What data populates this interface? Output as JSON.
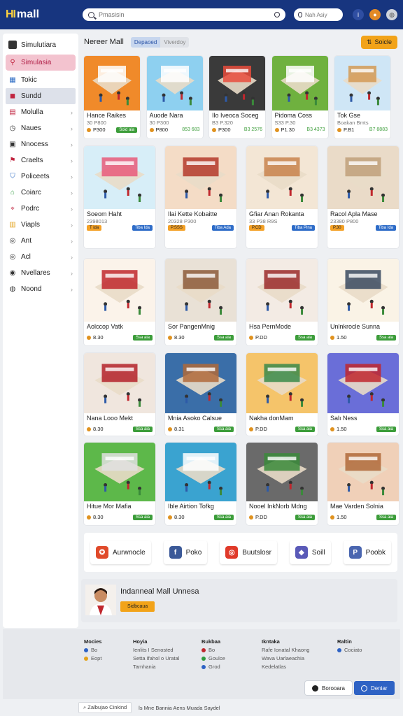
{
  "header": {
    "logo_mark": "HI",
    "logo_text": "mall",
    "search_placeholder": "Pmasisin",
    "search2_placeholder": "Nah Asiy"
  },
  "sidebar": {
    "title": "Simulutiara",
    "items": [
      {
        "label": "Simulasia",
        "icon": "search-icon",
        "state": "active"
      },
      {
        "label": "Tokic",
        "icon": "store-icon",
        "state": ""
      },
      {
        "label": "Sundd",
        "icon": "square-icon",
        "state": "selected"
      },
      {
        "label": "Molulla",
        "icon": "bar-chart-icon",
        "state": ""
      },
      {
        "label": "Naues",
        "icon": "clock-icon",
        "state": ""
      },
      {
        "label": "Nnocess",
        "icon": "grid-icon",
        "state": ""
      },
      {
        "label": "Craelts",
        "icon": "flag-icon",
        "state": ""
      },
      {
        "label": "Policeets",
        "icon": "shield-icon",
        "state": ""
      },
      {
        "label": "Coiarc",
        "icon": "shop-icon",
        "state": ""
      },
      {
        "label": "Podrc",
        "icon": "pin-icon",
        "state": ""
      },
      {
        "label": "Viapls",
        "icon": "bag-icon",
        "state": ""
      },
      {
        "label": "Ant",
        "icon": "compass-icon",
        "state": ""
      },
      {
        "label": "Acl",
        "icon": "compass-icon",
        "state": ""
      },
      {
        "label": "Nvellares",
        "icon": "target-icon",
        "state": ""
      },
      {
        "label": "Noond",
        "icon": "globe-icon",
        "state": ""
      }
    ]
  },
  "main": {
    "title": "Nereer Mall",
    "toggle": [
      "Depaoed",
      "Viverdoy"
    ],
    "sort_label": "Soicle"
  },
  "cards": [
    {
      "name": "Hance Raikes",
      "sub": "30 P800",
      "price": "P300",
      "badge": "Soid aia",
      "badge_type": "green"
    },
    {
      "name": "Auode Nara",
      "sub": "30 P300",
      "price": "P800",
      "badge": "853 683",
      "badge_type": "none"
    },
    {
      "name": "Ilo Iveoca Soceg",
      "sub": "B3 P.320",
      "price": "P300",
      "badge": "B3 2576",
      "badge_type": "none"
    },
    {
      "name": "Pidoma Coss",
      "sub": "S33 P.30",
      "price": "P1.30",
      "badge": "B3 4373",
      "badge_type": "none"
    },
    {
      "name": "Tok Gse",
      "sub": "Boakan Bmts",
      "price": "P.B1",
      "badge": "B7 8883",
      "badge_type": "none"
    },
    {
      "name": "Soeom Haht",
      "sub": "2398013",
      "price": "T ida",
      "badge": "Tiba Ida",
      "badge_type": "blue"
    },
    {
      "name": "Ilai Kette Kobaitte",
      "sub": "20328 P300",
      "price": "P.SSS",
      "badge": "Tiba Ada",
      "badge_type": "blue"
    },
    {
      "name": "Gfiar Anan Rokanta",
      "sub": "33 P38 R9S",
      "price": "P.CD",
      "badge": "Tiba Pina",
      "badge_type": "blue"
    },
    {
      "name": "Racol Apla Mase",
      "sub": "23380 P800",
      "price": "P.30",
      "badge": "Tiba Ida",
      "badge_type": "blue"
    },
    {
      "name": "Aolccop Vatk",
      "sub": "",
      "price": "8.30",
      "badge": "Ssa aia",
      "badge_type": "green"
    },
    {
      "name": "Sor PangenMnig",
      "sub": "",
      "price": "8.30",
      "badge": "Ssa aia",
      "badge_type": "green"
    },
    {
      "name": "Hsa PernMode",
      "sub": "",
      "price": "P.DD",
      "badge": "Ssa aia",
      "badge_type": "green"
    },
    {
      "name": "Unlnkrocle Sunna",
      "sub": "",
      "price": "1.50",
      "badge": "Ssa aia",
      "badge_type": "green"
    },
    {
      "name": "Nana Looo Mekt",
      "sub": "",
      "price": "8.30",
      "badge": "Ssa aia",
      "badge_type": "green"
    },
    {
      "name": "Mnia Asoko Calsue",
      "sub": "",
      "price": "8.31",
      "badge": "Ssa aia",
      "badge_type": "green"
    },
    {
      "name": "Nakha donMam",
      "sub": "",
      "price": "P.DD",
      "badge": "Ssa aia",
      "badge_type": "green"
    },
    {
      "name": "Salı Ness",
      "sub": "",
      "price": "1.50",
      "badge": "Ssa aia",
      "badge_type": "green"
    },
    {
      "name": "Hitue Mor Mafia",
      "sub": "",
      "price": "8.30",
      "badge": "Ssa aia",
      "badge_type": "green"
    },
    {
      "name": "Ible Airtion Tofkg",
      "sub": "",
      "price": "8.30",
      "badge": "Ssa aia",
      "badge_type": "green"
    },
    {
      "name": "Nooel InkNorb Mdng",
      "sub": "",
      "price": "P.DD",
      "badge": "Ssa aia",
      "badge_type": "green"
    },
    {
      "name": "Mae Varden Solnia",
      "sub": "",
      "price": "1.50",
      "badge": "Ssa aia",
      "badge_type": "green"
    }
  ],
  "partners": [
    {
      "label": "Aurwnocle",
      "icon": "badge-icon",
      "color": "#e04a2a"
    },
    {
      "label": "Poko",
      "icon": "f-icon",
      "color": "#3b5998"
    },
    {
      "label": "Buutslosr",
      "icon": "ring-icon",
      "color": "#e03a2a"
    },
    {
      "label": "Soill",
      "icon": "diamond-icon",
      "color": "#5a5ab8"
    },
    {
      "label": "Poobk",
      "icon": "p-icon",
      "color": "#4a66b0"
    }
  ],
  "promo": {
    "title": "Indanneal Mall Unnesa",
    "button": "Sidbcaua"
  },
  "footer": {
    "cols": [
      {
        "title": "Mocies",
        "lines": [
          "Bo",
          "Eopt"
        ]
      },
      {
        "title": "Hoyia",
        "lines": [
          "Ienlits I Senosted",
          "Setta Ifahol o Uratal",
          "Tamhania"
        ]
      },
      {
        "title": "Bukbaa",
        "lines": [
          "Bo",
          "Goulce",
          "Grod"
        ]
      },
      {
        "title": "Ikntaka",
        "lines": [
          "Rafe Ionatal Khaong",
          "Wava Uarlaeachia",
          "Kedelatlas"
        ]
      },
      {
        "title": "Raltin",
        "lines": [
          "Cociato"
        ]
      }
    ],
    "btn_secondary": "Borooara",
    "btn_primary": "Deniar"
  },
  "statusbar": {
    "search": "Zalbujao Cinkind",
    "text": "ls Mne Bannia Aens Muada Saydel"
  },
  "colors": {
    "header": "#17357f",
    "accent_orange": "#f2a319",
    "active_pink": "#f3c3cf",
    "green": "#3c9d3a",
    "blue": "#2e6cc8"
  }
}
